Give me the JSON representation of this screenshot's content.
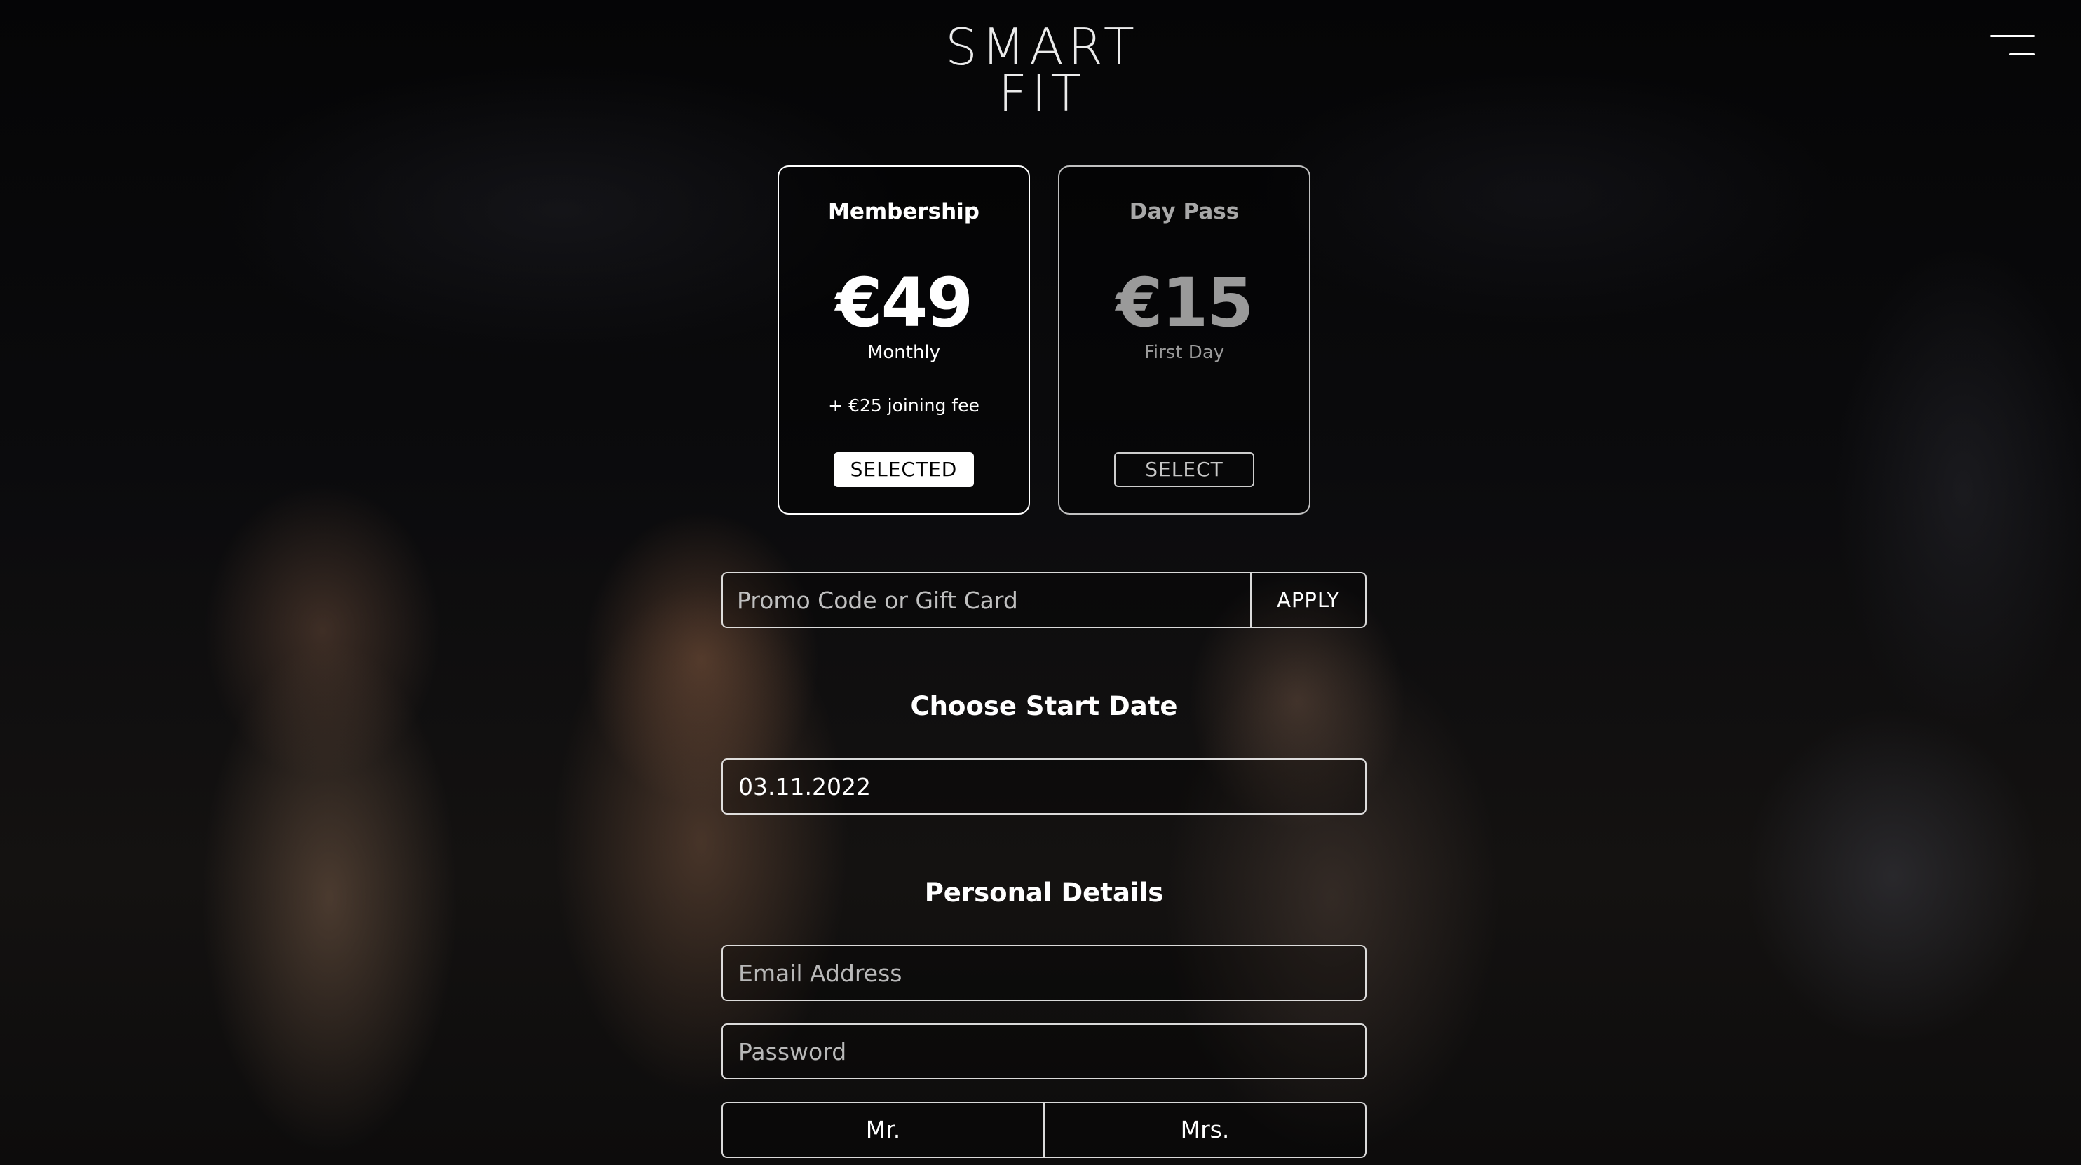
{
  "header": {
    "logo_text": "SMART FIT",
    "menu_icon": "menu-icon"
  },
  "plans": [
    {
      "title": "Membership",
      "price": "€49",
      "period": "Monthly",
      "note": "+ €25 joining fee",
      "button_label": "SELECTED",
      "selected": true
    },
    {
      "title": "Day Pass",
      "price": "€15",
      "period": "First Day",
      "note": "",
      "button_label": "SELECT",
      "selected": false
    }
  ],
  "promo": {
    "placeholder": "Promo Code or Gift Card",
    "value": "",
    "apply_label": "APPLY"
  },
  "start_date": {
    "heading": "Choose Start Date",
    "value": "03.11.2022"
  },
  "personal": {
    "heading": "Personal Details",
    "email_placeholder": "Email Address",
    "password_placeholder": "Password",
    "salutation_options": [
      "Mr.",
      "Mrs."
    ]
  }
}
